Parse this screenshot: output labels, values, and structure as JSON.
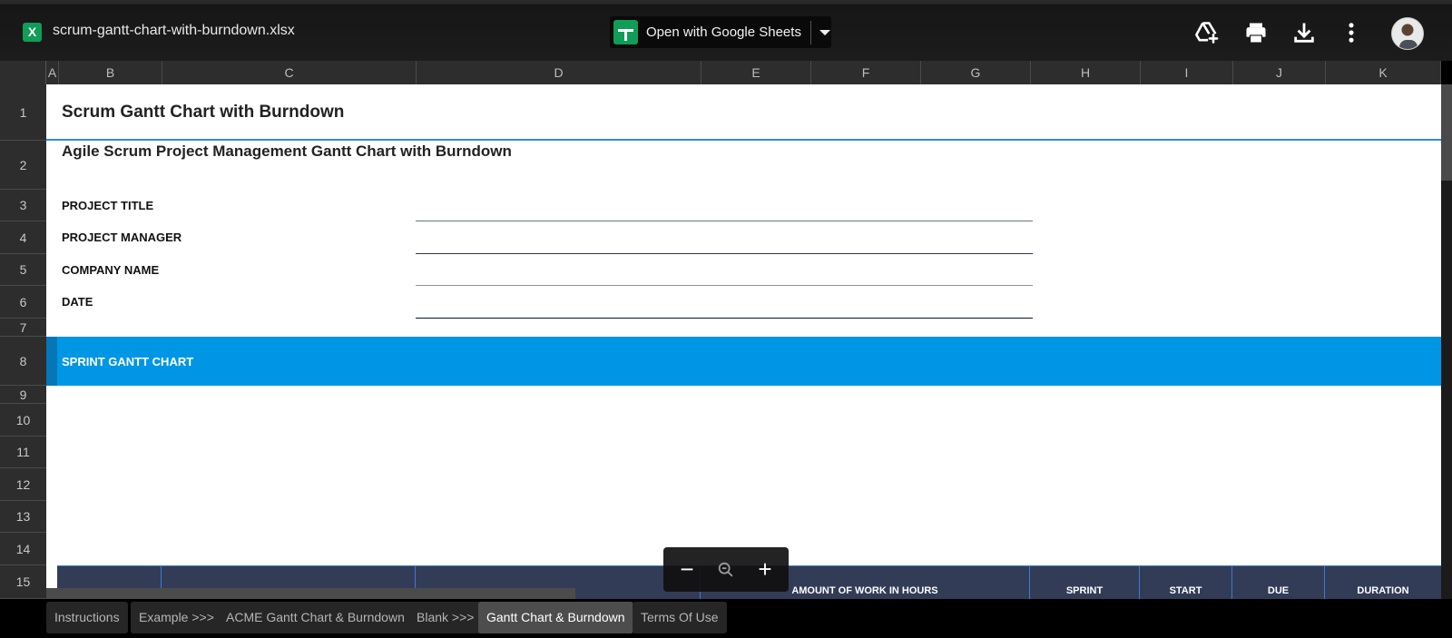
{
  "topbar": {
    "file_icon_letter": "X",
    "file_name": "scrum-gantt-chart-with-burndown.xlsx",
    "open_button_label": "Open with Google Sheets",
    "icons": [
      "add-to-drive-icon",
      "print-icon",
      "download-icon",
      "more-vert-icon",
      "avatar"
    ]
  },
  "columns": [
    "A",
    "B",
    "C",
    "D",
    "E",
    "F",
    "G",
    "H",
    "I",
    "J",
    "K"
  ],
  "rows": [
    "1",
    "2",
    "3",
    "4",
    "5",
    "6",
    "7",
    "8",
    "9",
    "10",
    "11",
    "12",
    "13",
    "14",
    "15"
  ],
  "sheet": {
    "title": "Scrum Gantt Chart with Burndown",
    "subtitle": "Agile Scrum Project Management Gantt Chart with Burndown",
    "fields": [
      {
        "label": "PROJECT TITLE",
        "value": ""
      },
      {
        "label": "PROJECT MANAGER",
        "value": ""
      },
      {
        "label": "COMPANY NAME",
        "value": ""
      },
      {
        "label": "DATE",
        "value": ""
      }
    ],
    "section_band": "SPRINT GANTT CHART",
    "band_color": "#0096e6",
    "table_header": {
      "color": "#333c57",
      "cells": [
        "",
        "",
        "",
        "AMOUNT OF WORK IN HOURS",
        "SPRINT",
        "START",
        "DUE",
        "DURATION"
      ]
    }
  },
  "zoom_control": {
    "minus": "−",
    "plus": "+"
  },
  "tabs": [
    {
      "label": "Instructions",
      "active": false
    },
    {
      "label": "Example >>>",
      "active": false
    },
    {
      "label": "ACME Gantt Chart & Burndown",
      "active": false
    },
    {
      "label": "Blank >>>",
      "active": false
    },
    {
      "label": "Gantt Chart & Burndown",
      "active": true
    },
    {
      "label": "Terms Of Use",
      "active": false
    }
  ]
}
